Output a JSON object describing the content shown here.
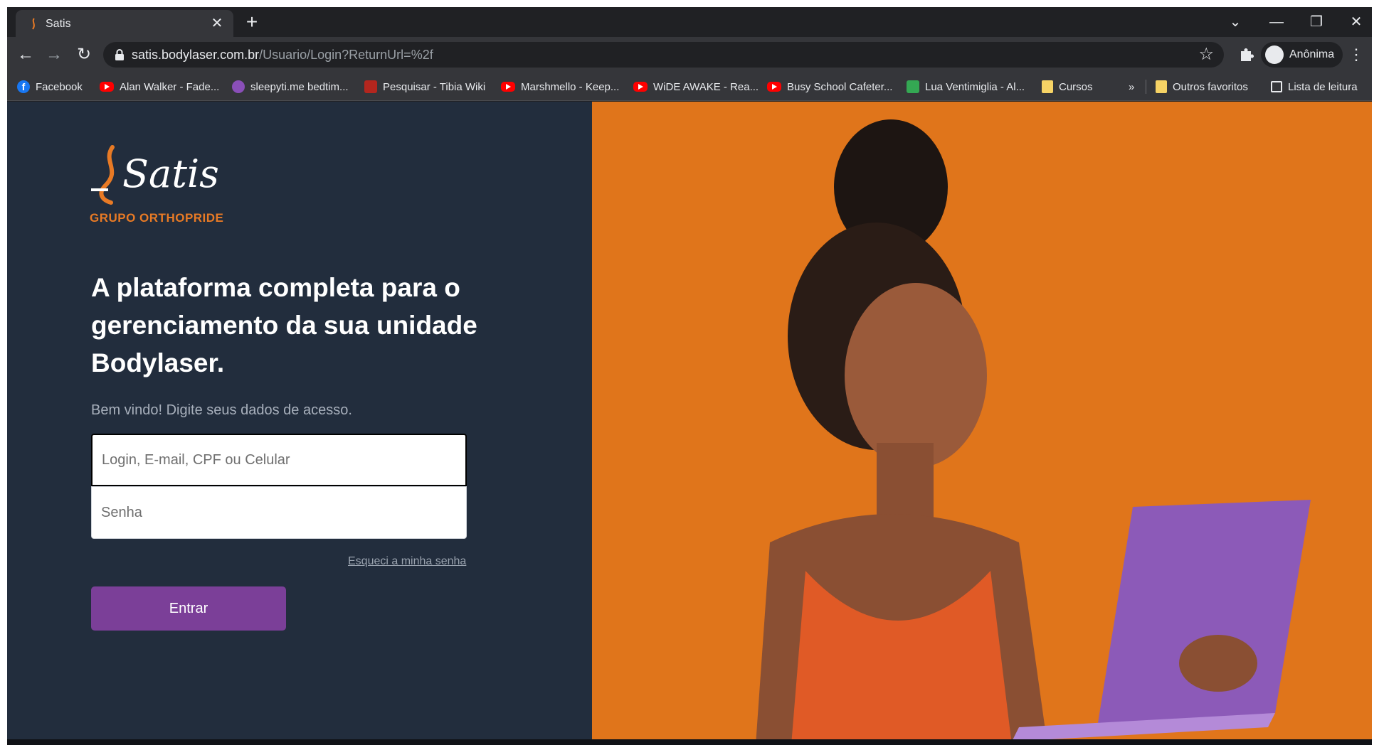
{
  "browser": {
    "tab_title": "Satis",
    "tab_close": "✕",
    "new_tab": "+",
    "window_controls": {
      "tab_search": "⌄",
      "minimize": "—",
      "restore": "❐",
      "close": "✕"
    },
    "url_host": "satis.bodylaser.com.br",
    "url_path": "/Usuario/Login?ReturnUrl=%2f",
    "star": "☆",
    "profile_label": "Anônima",
    "menu": "⋮",
    "back": "←",
    "forward": "→",
    "reload": "↻"
  },
  "bookmarks": [
    {
      "label": "Facebook",
      "icon": "facebook-icon"
    },
    {
      "label": "Alan Walker - Fade...",
      "icon": "youtube-icon"
    },
    {
      "label": "sleepyti.me bedtim...",
      "icon": "sleepytime-icon"
    },
    {
      "label": "Pesquisar - Tibia Wiki",
      "icon": "tibia-icon"
    },
    {
      "label": "Marshmello - Keep...",
      "icon": "youtube-icon"
    },
    {
      "label": "WiDE AWAKE - Rea...",
      "icon": "youtube-icon"
    },
    {
      "label": "Busy School Cafeter...",
      "icon": "youtube-icon"
    },
    {
      "label": "Lua Ventimiglia - Al...",
      "icon": "map-icon"
    },
    {
      "label": "Cursos",
      "icon": "folder-icon"
    }
  ],
  "bookmarks_overflow": "»",
  "bookmarks_other": "Outros favoritos",
  "reading_list": "Lista de leitura",
  "page": {
    "logo_text": "Satis",
    "logo_sub": "GRUPO ORTHOPRIDE",
    "headline": "A plataforma completa para o gerenciamento da sua unidade Bodylaser.",
    "subtitle": "Bem vindo! Digite seus dados de acesso.",
    "login_placeholder": "Login, E-mail, CPF ou Celular",
    "password_placeholder": "Senha",
    "forgot_link": "Esqueci a minha senha",
    "submit_label": "Entrar"
  },
  "colors": {
    "left_panel": "#222d3d",
    "right_panel": "#e0751b",
    "button": "#7b3f98",
    "logo_accent": "#e87a25"
  }
}
